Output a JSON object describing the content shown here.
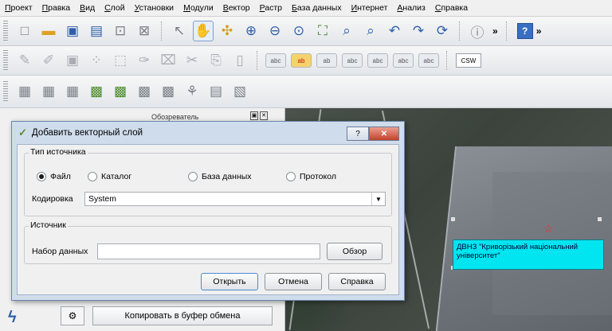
{
  "menu": [
    "Проект",
    "Правка",
    "Вид",
    "Слой",
    "Установки",
    "Модули",
    "Вектор",
    "Растр",
    "База данных",
    "Интернет",
    "Анализ",
    "Справка"
  ],
  "toolbar1": {
    "icons": [
      "new-project-icon",
      "open-project-icon",
      "save-project-icon",
      "save-as-icon",
      "new-print-composer-icon",
      "composer-manager-icon",
      "touch-zoom-icon",
      "pan-icon",
      "pan-to-selection-icon",
      "zoom-in-icon",
      "zoom-out-icon",
      "zoom-full-icon",
      "zoom-to-layer-icon",
      "zoom-to-selection-icon",
      "zoom-last-icon",
      "zoom-next-icon",
      "refresh-icon",
      "identify-icon"
    ],
    "more": "»",
    "help": "?"
  },
  "toolbar2": {
    "csw": "CSW",
    "label_tools": [
      "abc",
      "ab",
      "ab",
      "abc",
      "abc",
      "abc",
      "abc"
    ]
  },
  "panel": {
    "header": "Обозреватель"
  },
  "copy_button": "Копировать в буфер обмена",
  "map": {
    "label": "ДВНЗ \"Криворізький національний університет\"",
    "accent": "#00e5f0"
  },
  "dialog": {
    "title": "Добавить векторный слой",
    "help_btn": "?",
    "close_btn": "✕",
    "source_type_legend": "Тип источника",
    "options": [
      "Файл",
      "Каталог",
      "База данных",
      "Протокол"
    ],
    "selected_option": "Файл",
    "encoding_label": "Кодировка",
    "encoding_value": "System",
    "source_legend": "Источник",
    "dataset_label": "Набор данных",
    "dataset_value": "",
    "browse_btn": "Обзор",
    "open_btn": "Открыть",
    "cancel_btn": "Отмена",
    "help_button": "Справка"
  }
}
